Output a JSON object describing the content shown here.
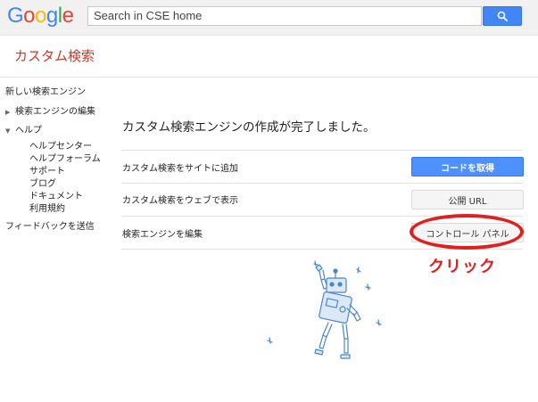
{
  "topbar": {
    "logo_letters": [
      {
        "char": "G",
        "color": "#4285f4"
      },
      {
        "char": "o",
        "color": "#ea4335"
      },
      {
        "char": "o",
        "color": "#fbbc05"
      },
      {
        "char": "g",
        "color": "#4285f4"
      },
      {
        "char": "l",
        "color": "#34a853"
      },
      {
        "char": "e",
        "color": "#ea4335"
      }
    ],
    "search_value": "Search in CSE home",
    "search_icon": "magnifier-icon"
  },
  "header": {
    "title": "カスタム検索"
  },
  "sidebar": {
    "item_new": "新しい検索エンジン",
    "item_edit": "検索エンジンの編集",
    "item_help": "ヘルプ",
    "help_children": [
      "ヘルプセンター",
      "ヘルプフォーラム",
      "サポート",
      "ブログ",
      "ドキュメント",
      "利用規約"
    ],
    "item_feedback": "フィードバックを送信"
  },
  "main": {
    "heading": "カスタム検索エンジンの作成が完了しました。",
    "rows": [
      {
        "label": "カスタム検索をサイトに追加",
        "button": "コードを取得"
      },
      {
        "label": "カスタム検索をウェブで表示",
        "button": "公開 URL"
      },
      {
        "label": "検索エンジンを編集",
        "button": "コントロール パネル"
      }
    ]
  },
  "annotation": {
    "text": "クリック",
    "color": "#e02020"
  },
  "illustration": {
    "name": "robot-illustration",
    "color": "#4a86c8"
  }
}
